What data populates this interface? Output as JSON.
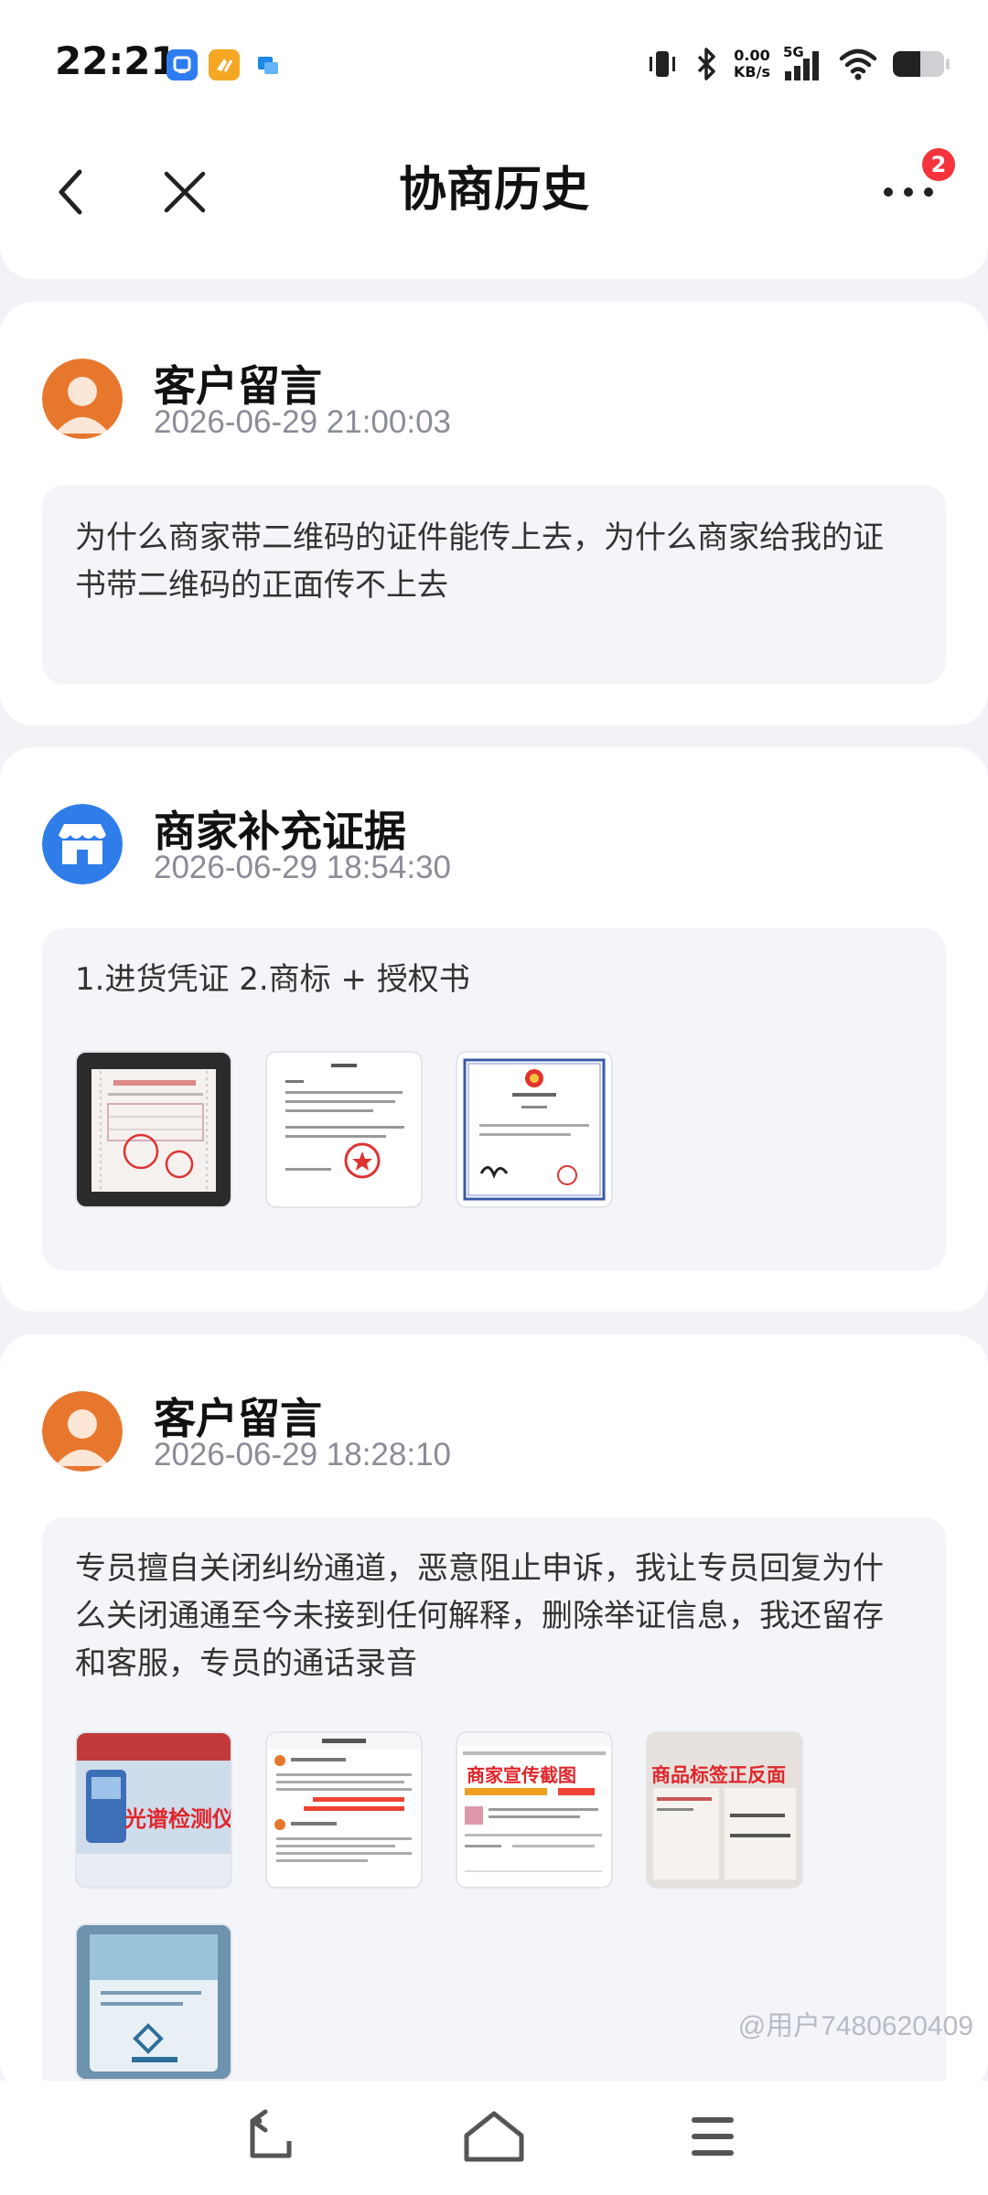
{
  "status_bar": {
    "time": "22:21",
    "speed_value": "0.00",
    "speed_unit": "KB/s",
    "network": "5G",
    "icons": [
      "app-icon-1",
      "app-icon-2",
      "app-icon-3",
      "vibrate-icon",
      "bluetooth-icon",
      "signal-icon",
      "wifi-icon",
      "battery-icon"
    ]
  },
  "header": {
    "title": "协商历史",
    "back_icon": "chevron-left-icon",
    "close_icon": "close-icon",
    "more_icon": "more-icon",
    "more_badge": "2"
  },
  "entries": [
    {
      "author": "客户留言",
      "timestamp": "2026-06-29 21:00:03",
      "avatar": "user-avatar-icon",
      "text_lines": [
        "为什么商家带二维码的证件能传上去，为什么商家给我的证",
        "书带二维码的正面传不上去"
      ]
    },
    {
      "author": "商家补充证据",
      "timestamp": "2026-06-29 18:54:30",
      "avatar": "store-avatar-icon",
      "text_lines": [
        "1.进货凭证 2.商标 + 授权书"
      ],
      "images": [
        "invoice-photo",
        "authorization-letter",
        "trademark-certificate"
      ]
    },
    {
      "author": "客户留言",
      "timestamp": "2026-06-29 18:28:10",
      "avatar": "user-avatar-icon",
      "text_lines": [
        "专员擅自关闭纠纷通道，恶意阻止申诉，我让专员回复为什",
        "么关闭通通至今未接到任何解释，删除举证信息，我还留存",
        "和客服，专员的通话录音"
      ],
      "images": [
        "detector-photo",
        "negotiation-screenshot",
        "merchant-promo-screenshot",
        "product-label-photo",
        "box-photo"
      ],
      "image_texts": {
        "detector": "光谱检测仪",
        "promo": "商家宣传截图",
        "label": "商品标签正反面"
      }
    }
  ],
  "nav_bar": {
    "icons": [
      "back-nav-icon",
      "home-nav-icon",
      "menu-nav-icon"
    ]
  },
  "watermark": "@用户7480620409",
  "colors": {
    "accent_orange": "#e8772e",
    "store_blue": "#2e7de8",
    "badge_red": "#f4333c"
  }
}
